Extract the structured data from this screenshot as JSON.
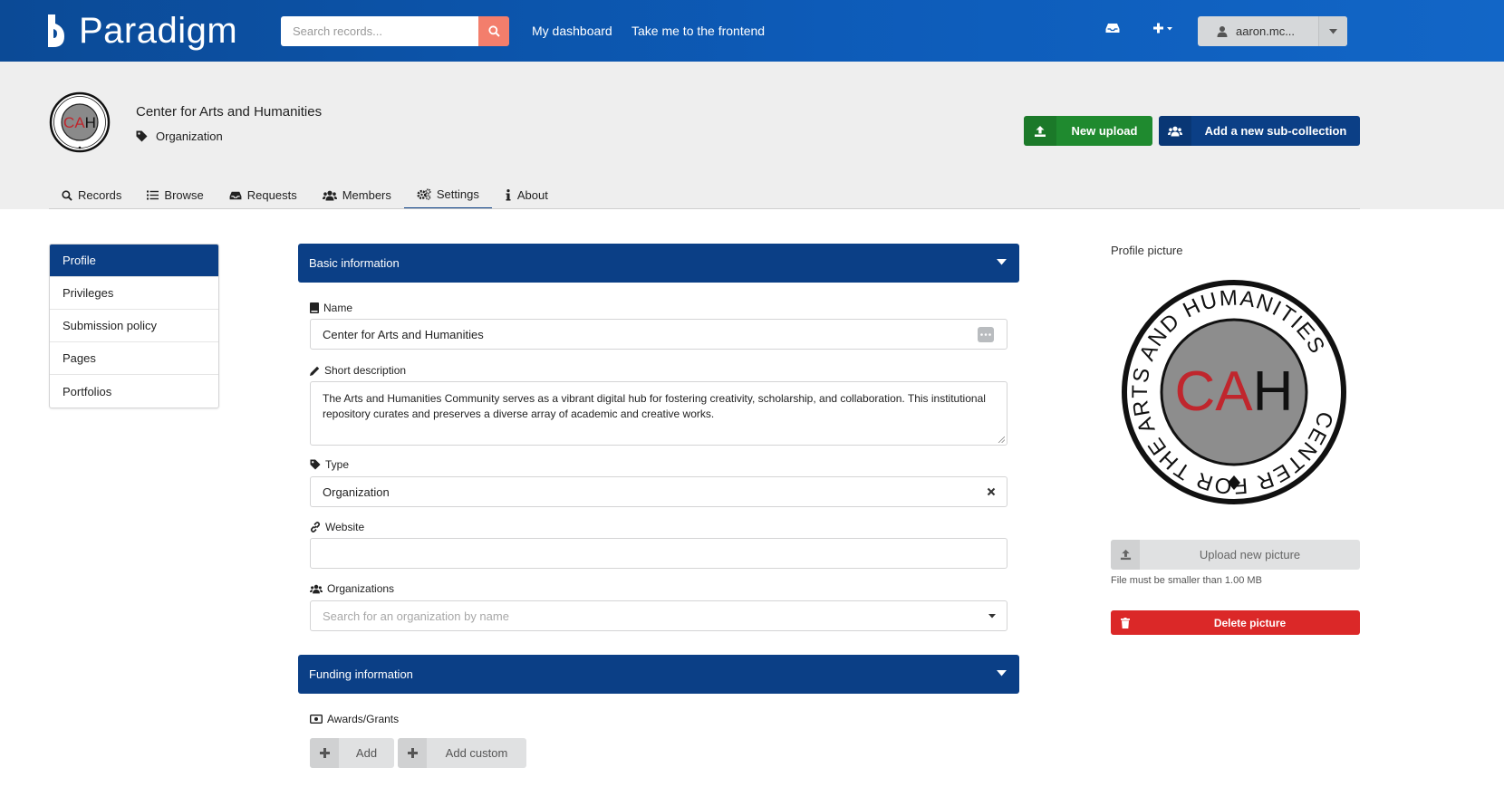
{
  "app": {
    "name": "Paradigm"
  },
  "topbar": {
    "search_placeholder": "Search records...",
    "links": [
      "My dashboard",
      "Take me to the frontend"
    ],
    "icons": [
      "inbox-icon",
      "plus-icon",
      "user-icon"
    ],
    "user_label": "aaron.mc..."
  },
  "community": {
    "title": "Center for Arts and Humanities",
    "type": "Organization",
    "logo_text": "CAH",
    "logo_ring_text": "CENTER FOR THE ARTS AND HUMANITIES"
  },
  "actions": {
    "new_upload": "New upload",
    "add_subcollection": "Add a new sub-collection"
  },
  "tabs": [
    {
      "label": "Records",
      "icon": "search-icon"
    },
    {
      "label": "Browse",
      "icon": "list-icon"
    },
    {
      "label": "Requests",
      "icon": "inbox-icon"
    },
    {
      "label": "Members",
      "icon": "users-icon"
    },
    {
      "label": "Settings",
      "icon": "cogs-icon",
      "active": true
    },
    {
      "label": "About",
      "icon": "info-icon"
    }
  ],
  "sidemenu": [
    {
      "label": "Profile",
      "active": true
    },
    {
      "label": "Privileges"
    },
    {
      "label": "Submission policy"
    },
    {
      "label": "Pages"
    },
    {
      "label": "Portfolios"
    }
  ],
  "basic": {
    "header": "Basic information",
    "name_label": "Name",
    "name_value": "Center for Arts and Humanities",
    "desc_label": "Short description",
    "desc_value": "The Arts and Humanities Community serves as a vibrant digital hub for fostering creativity, scholarship, and collaboration. This institutional repository curates and preserves a diverse array of academic and creative works.",
    "type_label": "Type",
    "type_value": "Organization",
    "website_label": "Website",
    "website_value": "",
    "orgs_label": "Organizations",
    "orgs_placeholder": "Search for an organization by name"
  },
  "funding": {
    "header": "Funding information",
    "awards_label": "Awards/Grants",
    "add_label": "Add",
    "add_custom_label": "Add custom"
  },
  "profile_picture": {
    "label": "Profile picture",
    "upload_label": "Upload new picture",
    "hint": "File must be smaller than 1.00 MB",
    "delete_label": "Delete picture"
  },
  "colors": {
    "primary": "#0b3f86",
    "topbar": "#0d5bb8",
    "success": "#1f8a2f",
    "danger": "#db2828",
    "search_btn": "#f37e6c",
    "logo_red": "#c0262d"
  }
}
